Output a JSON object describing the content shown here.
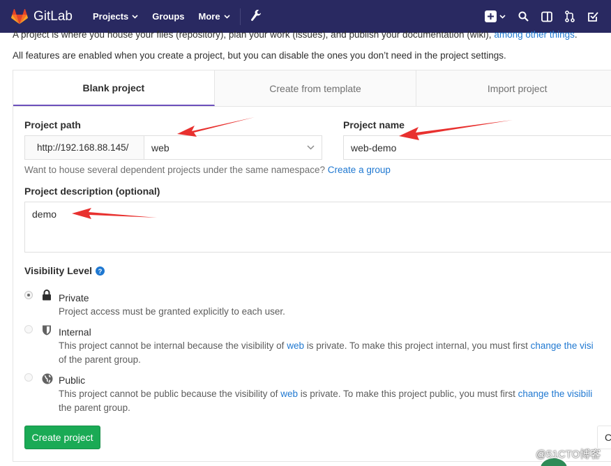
{
  "nav": {
    "brand": "GitLab",
    "projects": "Projects",
    "groups": "Groups",
    "more": "More"
  },
  "intro": {
    "line1_text": "A project is where you house your files (repository), plan your work (issues), and publish your documentation (wiki),",
    "line1_link": "among other things",
    "line1_end": ".",
    "line2": "All features are enabled when you create a project, but you can disable the ones you don’t need in the project settings."
  },
  "tabs": [
    {
      "label": "Blank project",
      "active": true
    },
    {
      "label": "Create from template",
      "active": false
    },
    {
      "label": "Import project",
      "active": false
    }
  ],
  "form": {
    "path_label": "Project path",
    "path_prefix": "http://192.168.88.145/",
    "path_namespace": "web",
    "name_label": "Project name",
    "name_value": "web-demo",
    "hint_text": "Want to house several dependent projects under the same namespace?",
    "hint_link": "Create a group",
    "desc_label": "Project description (optional)",
    "desc_value": "demo",
    "visibility_label": "Visibility Level",
    "help_icon": "question-circle-icon"
  },
  "visibility": [
    {
      "title": "Private",
      "icon": "lock-icon",
      "selected": true,
      "desc_line1": "Project access must be granted explicitly to each user.",
      "desc_line1_pre": "",
      "desc_line1_link": "",
      "desc_line1_mid": "",
      "desc_line1_link2": "",
      "desc_line2": ""
    },
    {
      "title": "Internal",
      "icon": "shield-icon",
      "selected": false,
      "desc_line1_pre": "This project cannot be internal because the visibility of",
      "desc_line1_link": "web",
      "desc_line1_mid": "is private. To make this project internal, you must first",
      "desc_line1_link2": "change the visi",
      "desc_line2": "of the parent group."
    },
    {
      "title": "Public",
      "icon": "globe-icon",
      "selected": false,
      "desc_line1_pre": "This project cannot be public because the visibility of",
      "desc_line1_link": "web",
      "desc_line1_mid": "is private. To make this project public, you must first",
      "desc_line1_link2": "change the visibili",
      "desc_line2": "the parent group."
    }
  ],
  "buttons": {
    "create": "Create project",
    "cancel": "C"
  },
  "watermark": "@51CTO博客",
  "colors": {
    "navbar": "#292961",
    "accent": "#6b4fbb",
    "create_button": "#1aaa55",
    "link": "#1f78d1",
    "annotation_arrow": "#e8312f"
  }
}
